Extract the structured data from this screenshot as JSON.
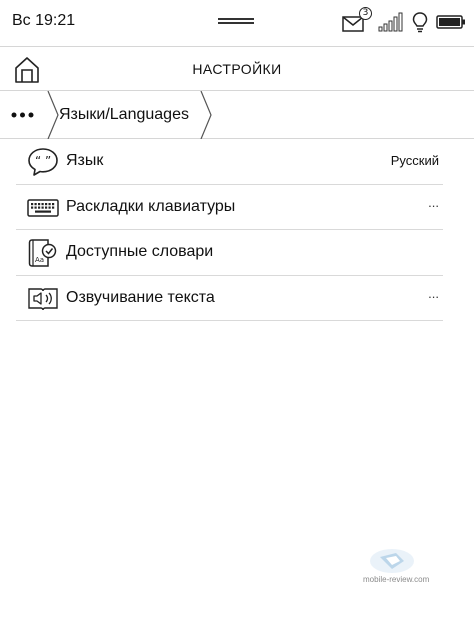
{
  "status_bar": {
    "time": "Вс 19:21",
    "mail_count": "3",
    "icons": [
      "mail-icon",
      "signal-icon",
      "bulb-icon",
      "battery-icon"
    ]
  },
  "header": {
    "title": "НАСТРОЙКИ",
    "home_icon": "home-icon"
  },
  "breadcrumb": {
    "more_icon": "more-dots-icon",
    "current": "Языки/Languages"
  },
  "settings": [
    {
      "label": "Язык",
      "value": "Русский",
      "icon": "speech-bubble-icon"
    },
    {
      "label": "Раскладки клавиатуры",
      "more": "...",
      "icon": "keyboard-icon"
    },
    {
      "label": "Доступные словари",
      "icon": "dictionary-icon"
    },
    {
      "label": "Озвучивание текста",
      "more": "...",
      "icon": "speaker-book-icon"
    }
  ],
  "watermark": {
    "text": "mobile-review.com"
  },
  "colors": {
    "text": "#111111",
    "divider": "#d9d9d9",
    "background": "#ffffff"
  }
}
